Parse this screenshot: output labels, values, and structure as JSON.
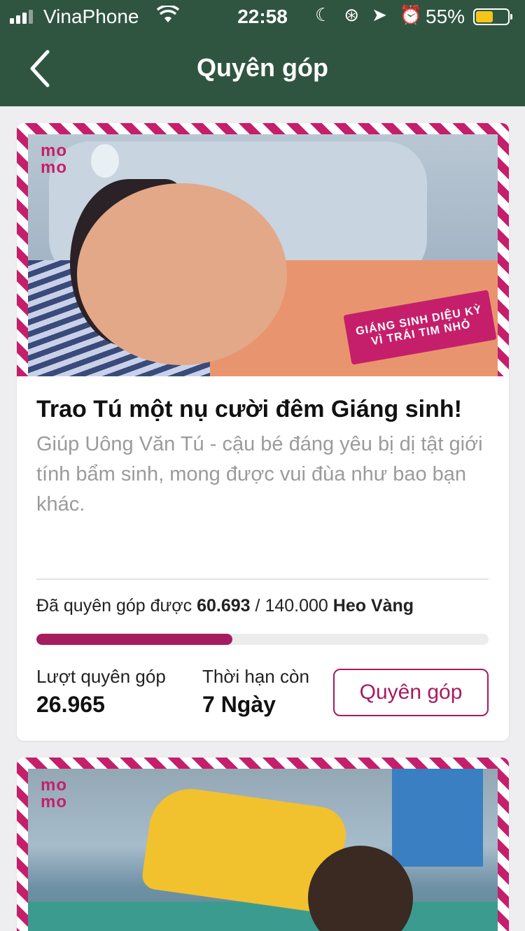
{
  "status_bar": {
    "carrier": "VinaPhone",
    "time": "22:58",
    "battery_percent": "55%",
    "battery_level": 0.55,
    "icons": [
      "signal-icon",
      "wifi-icon",
      "moon-icon",
      "orientation-lock-icon",
      "location-icon",
      "alarm-icon",
      "battery-icon"
    ]
  },
  "nav": {
    "title": "Quyên góp",
    "back_icon": "chevron-left-icon"
  },
  "colors": {
    "header_bg": "#2f5540",
    "accent": "#a71b5f",
    "stripe": "#c51f6b"
  },
  "cards": [
    {
      "logo": "momo",
      "badge_line1": "GIÁNG SINH DIỆU KỲ",
      "badge_line2": "VÌ TRÁI TIM NHỎ",
      "title": "Trao Tú một nụ cười đêm Giáng sinh!",
      "description": "Giúp Uông Văn Tú - cậu bé đáng yêu bị dị tật giới tính bẩm sinh, mong được vui đùa như bao bạn khác.",
      "raised_prefix": "Đã quyên góp được",
      "raised_amount": "60.693",
      "raised_separator": "/",
      "goal_amount": "140.000",
      "unit": "Heo Vàng",
      "progress_fraction": 0.4335,
      "donors_label": "Lượt quyên góp",
      "donors_value": "26.965",
      "deadline_label": "Thời hạn còn",
      "deadline_value": "7 Ngày",
      "donate_button": "Quyên góp"
    },
    {
      "logo": "momo"
    }
  ]
}
